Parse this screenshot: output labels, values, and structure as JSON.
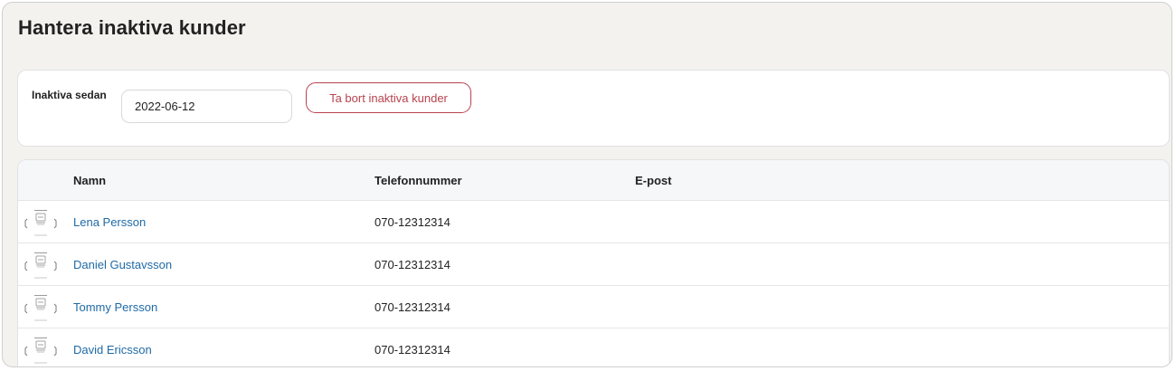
{
  "page": {
    "title": "Hantera inaktiva kunder"
  },
  "filter": {
    "label": "Inaktiva sedan",
    "date_value": "2022-06-12",
    "remove_button_label": "Ta bort inaktiva kunder"
  },
  "table": {
    "columns": {
      "name": "Namn",
      "phone": "Telefonnummer",
      "email": "E-post"
    },
    "rows": [
      {
        "icon": "contact-card-icon",
        "name": "Lena Persson",
        "phone": "070-12312314",
        "email": ""
      },
      {
        "icon": "contact-card-icon",
        "name": "Daniel Gustavsson",
        "phone": "070-12312314",
        "email": ""
      },
      {
        "icon": "contact-card-icon",
        "name": "Tommy Persson",
        "phone": "070-12312314",
        "email": ""
      },
      {
        "icon": "contact-card-icon",
        "name": "David Ericsson",
        "phone": "070-12312314",
        "email": ""
      }
    ]
  },
  "colors": {
    "page_background": "#f3f2ef",
    "accent_danger": "#b8434f",
    "link": "#1f6aa5"
  }
}
